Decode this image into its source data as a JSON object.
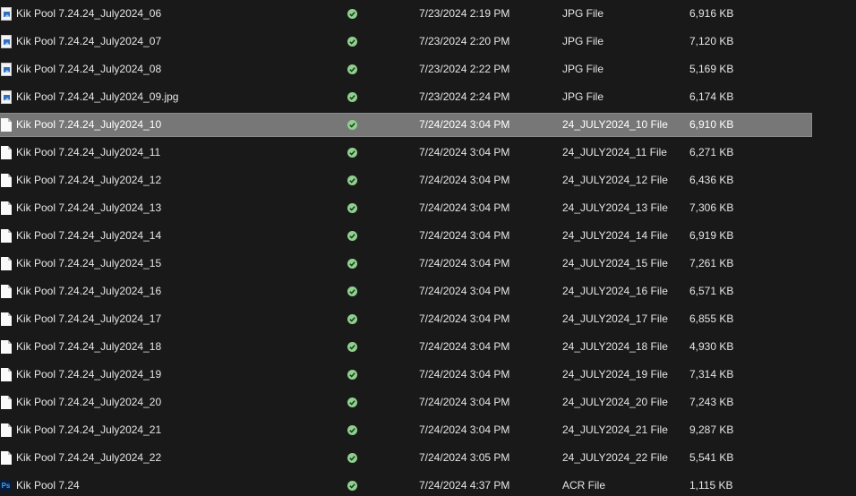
{
  "colors": {
    "background": "#191919",
    "selected_row": "#777777",
    "status_ok": "#8fd08f",
    "text": "#e6e6e6"
  },
  "icons": {
    "jpg": "jpg-file-icon",
    "file": "generic-file-icon",
    "photoshop": "photoshop-file-icon",
    "status": "available-status-icon"
  },
  "rows": [
    {
      "name": "Kik Pool 7.24.24_July2024_06",
      "date": "7/23/2024 2:19 PM",
      "type": "JPG File",
      "size": "6,916 KB",
      "icon": "jpg",
      "selected": false
    },
    {
      "name": "Kik Pool 7.24.24_July2024_07",
      "date": "7/23/2024 2:20 PM",
      "type": "JPG File",
      "size": "7,120 KB",
      "icon": "jpg",
      "selected": false
    },
    {
      "name": "Kik Pool 7.24.24_July2024_08",
      "date": "7/23/2024 2:22 PM",
      "type": "JPG File",
      "size": "5,169 KB",
      "icon": "jpg",
      "selected": false
    },
    {
      "name": "Kik Pool 7.24.24_July2024_09.jpg",
      "date": "7/23/2024 2:24 PM",
      "type": "JPG File",
      "size": "6,174 KB",
      "icon": "jpg",
      "selected": false
    },
    {
      "name": "Kik Pool 7.24.24_July2024_10",
      "date": "7/24/2024 3:04 PM",
      "type": "24_JULY2024_10 File",
      "size": "6,910 KB",
      "icon": "file",
      "selected": true
    },
    {
      "name": "Kik Pool 7.24.24_July2024_11",
      "date": "7/24/2024 3:04 PM",
      "type": "24_JULY2024_11 File",
      "size": "6,271 KB",
      "icon": "file",
      "selected": false
    },
    {
      "name": "Kik Pool 7.24.24_July2024_12",
      "date": "7/24/2024 3:04 PM",
      "type": "24_JULY2024_12 File",
      "size": "6,436 KB",
      "icon": "file",
      "selected": false
    },
    {
      "name": "Kik Pool 7.24.24_July2024_13",
      "date": "7/24/2024 3:04 PM",
      "type": "24_JULY2024_13 File",
      "size": "7,306 KB",
      "icon": "file",
      "selected": false
    },
    {
      "name": "Kik Pool 7.24.24_July2024_14",
      "date": "7/24/2024 3:04 PM",
      "type": "24_JULY2024_14 File",
      "size": "6,919 KB",
      "icon": "file",
      "selected": false
    },
    {
      "name": "Kik Pool 7.24.24_July2024_15",
      "date": "7/24/2024 3:04 PM",
      "type": "24_JULY2024_15 File",
      "size": "7,261 KB",
      "icon": "file",
      "selected": false
    },
    {
      "name": "Kik Pool 7.24.24_July2024_16",
      "date": "7/24/2024 3:04 PM",
      "type": "24_JULY2024_16 File",
      "size": "6,571 KB",
      "icon": "file",
      "selected": false
    },
    {
      "name": "Kik Pool 7.24.24_July2024_17",
      "date": "7/24/2024 3:04 PM",
      "type": "24_JULY2024_17 File",
      "size": "6,855 KB",
      "icon": "file",
      "selected": false
    },
    {
      "name": "Kik Pool 7.24.24_July2024_18",
      "date": "7/24/2024 3:04 PM",
      "type": "24_JULY2024_18 File",
      "size": "4,930 KB",
      "icon": "file",
      "selected": false
    },
    {
      "name": "Kik Pool 7.24.24_July2024_19",
      "date": "7/24/2024 3:04 PM",
      "type": "24_JULY2024_19 File",
      "size": "7,314 KB",
      "icon": "file",
      "selected": false
    },
    {
      "name": "Kik Pool 7.24.24_July2024_20",
      "date": "7/24/2024 3:04 PM",
      "type": "24_JULY2024_20 File",
      "size": "7,243 KB",
      "icon": "file",
      "selected": false
    },
    {
      "name": "Kik Pool 7.24.24_July2024_21",
      "date": "7/24/2024 3:04 PM",
      "type": "24_JULY2024_21 File",
      "size": "9,287 KB",
      "icon": "file",
      "selected": false
    },
    {
      "name": "Kik Pool 7.24.24_July2024_22",
      "date": "7/24/2024 3:05 PM",
      "type": "24_JULY2024_22 File",
      "size": "5,541 KB",
      "icon": "file",
      "selected": false
    },
    {
      "name": "Kik Pool 7.24",
      "date": "7/24/2024 4:37 PM",
      "type": "ACR File",
      "size": "1,115 KB",
      "icon": "photoshop",
      "icon_text": "Ps",
      "selected": false
    }
  ]
}
